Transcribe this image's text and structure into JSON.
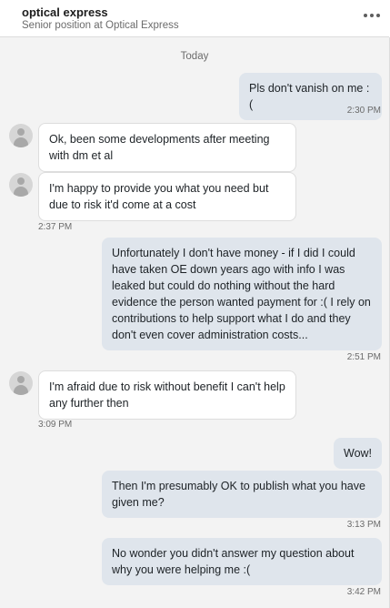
{
  "header": {
    "name": "optical express",
    "subtitle": "Senior position at Optical Express"
  },
  "thread": {
    "day_label": "Today",
    "messages": [
      {
        "direction": "out",
        "text": "Pls don't vanish on me :(",
        "time": "2:30 PM"
      },
      {
        "direction": "in",
        "text": "Ok, been some developments after meeting with dm et al",
        "time": ""
      },
      {
        "direction": "in",
        "text": "I'm happy to provide you what you need but due to risk it'd come at a cost",
        "time": "2:37 PM"
      },
      {
        "direction": "out",
        "text": "Unfortunately I don't have money - if I did I could have taken OE down years ago with info I was leaked but could do nothing without the hard evidence the person wanted payment for :( I rely on contributions to help support what I do and they don't even cover administration costs...",
        "time": "2:51 PM"
      },
      {
        "direction": "in",
        "text": "I'm afraid due to risk without benefit I can't help any further then",
        "time": "3:09 PM"
      },
      {
        "direction": "out",
        "text": "Wow!",
        "time": ""
      },
      {
        "direction": "out",
        "text": "Then I'm presumably OK to publish what you have given me?",
        "time": "3:13 PM"
      },
      {
        "direction": "out",
        "text": "No wonder you didn't answer my question about why you were helping me :(",
        "time": "3:42 PM"
      }
    ]
  }
}
